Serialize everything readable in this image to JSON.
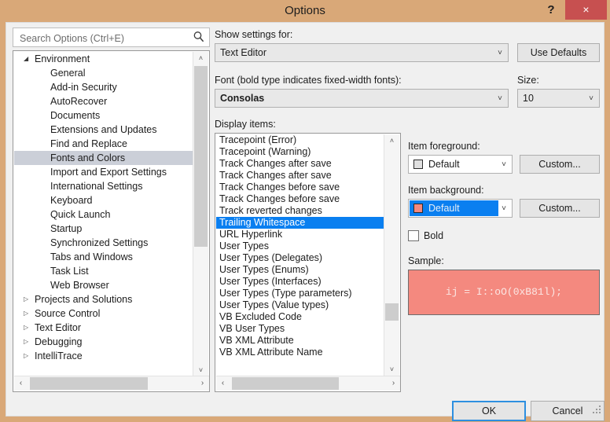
{
  "window": {
    "title": "Options",
    "help_label": "?",
    "close_label": "×",
    "titlebar_color": "#d9a878",
    "close_color": "#c75050"
  },
  "search": {
    "placeholder": "Search Options (Ctrl+E)",
    "value": "",
    "icon": "search-icon"
  },
  "tree": {
    "items": [
      {
        "label": "Environment",
        "level": 0,
        "state": "expanded",
        "selected": false
      },
      {
        "label": "General",
        "level": 1,
        "state": "leaf",
        "selected": false
      },
      {
        "label": "Add-in Security",
        "level": 1,
        "state": "leaf",
        "selected": false
      },
      {
        "label": "AutoRecover",
        "level": 1,
        "state": "leaf",
        "selected": false
      },
      {
        "label": "Documents",
        "level": 1,
        "state": "leaf",
        "selected": false
      },
      {
        "label": "Extensions and Updates",
        "level": 1,
        "state": "leaf",
        "selected": false
      },
      {
        "label": "Find and Replace",
        "level": 1,
        "state": "leaf",
        "selected": false
      },
      {
        "label": "Fonts and Colors",
        "level": 1,
        "state": "leaf",
        "selected": true
      },
      {
        "label": "Import and Export Settings",
        "level": 1,
        "state": "leaf",
        "selected": false
      },
      {
        "label": "International Settings",
        "level": 1,
        "state": "leaf",
        "selected": false
      },
      {
        "label": "Keyboard",
        "level": 1,
        "state": "leaf",
        "selected": false
      },
      {
        "label": "Quick Launch",
        "level": 1,
        "state": "leaf",
        "selected": false
      },
      {
        "label": "Startup",
        "level": 1,
        "state": "leaf",
        "selected": false
      },
      {
        "label": "Synchronized Settings",
        "level": 1,
        "state": "leaf",
        "selected": false
      },
      {
        "label": "Tabs and Windows",
        "level": 1,
        "state": "leaf",
        "selected": false
      },
      {
        "label": "Task List",
        "level": 1,
        "state": "leaf",
        "selected": false
      },
      {
        "label": "Web Browser",
        "level": 1,
        "state": "leaf",
        "selected": false
      },
      {
        "label": "Projects and Solutions",
        "level": 0,
        "state": "collapsed",
        "selected": false
      },
      {
        "label": "Source Control",
        "level": 0,
        "state": "collapsed",
        "selected": false
      },
      {
        "label": "Text Editor",
        "level": 0,
        "state": "collapsed",
        "selected": false
      },
      {
        "label": "Debugging",
        "level": 0,
        "state": "collapsed",
        "selected": false
      },
      {
        "label": "IntelliTrace",
        "level": 0,
        "state": "collapsed",
        "selected": false
      }
    ],
    "selected_label": "Fonts and Colors",
    "expanded_arrow": "◢",
    "collapsed_arrow": "▷",
    "scroll_up": "˄",
    "scroll_down": "˅",
    "scroll_left": "‹",
    "scroll_right": "›"
  },
  "show_settings": {
    "label": "Show settings for:",
    "value": "Text Editor",
    "arrow": "˅"
  },
  "use_defaults": {
    "label": "Use Defaults"
  },
  "font": {
    "label": "Font (bold type indicates fixed-width fonts):",
    "value": "Consolas",
    "arrow": "˅"
  },
  "size": {
    "label": "Size:",
    "value": "10",
    "arrow": "˅"
  },
  "display_items": {
    "label": "Display items:",
    "selected": "Trailing Whitespace",
    "items": [
      {
        "label": "Tracepoint (Error)",
        "selected": false
      },
      {
        "label": "Tracepoint (Warning)",
        "selected": false
      },
      {
        "label": "Track Changes after save",
        "selected": false
      },
      {
        "label": "Track Changes after save",
        "selected": false
      },
      {
        "label": "Track Changes before save",
        "selected": false
      },
      {
        "label": "Track Changes before save",
        "selected": false
      },
      {
        "label": "Track reverted changes",
        "selected": false
      },
      {
        "label": "Trailing Whitespace",
        "selected": true
      },
      {
        "label": "URL Hyperlink",
        "selected": false
      },
      {
        "label": "User Types",
        "selected": false
      },
      {
        "label": "User Types (Delegates)",
        "selected": false
      },
      {
        "label": "User Types (Enums)",
        "selected": false
      },
      {
        "label": "User Types (Interfaces)",
        "selected": false
      },
      {
        "label": "User Types (Type parameters)",
        "selected": false
      },
      {
        "label": "User Types (Value types)",
        "selected": false
      },
      {
        "label": "VB Excluded Code",
        "selected": false
      },
      {
        "label": "VB User Types",
        "selected": false
      },
      {
        "label": "VB XML Attribute",
        "selected": false
      },
      {
        "label": "VB XML Attribute Name",
        "selected": false
      }
    ],
    "selection_color": "#0a7ff0"
  },
  "item_foreground": {
    "label": "Item foreground:",
    "value": "Default",
    "swatch_color": "#e0e0e0",
    "arrow": "˅",
    "custom_label": "Custom..."
  },
  "item_background": {
    "label": "Item background:",
    "value": "Default",
    "swatch_color": "#f4897f",
    "arrow": "˅",
    "custom_label": "Custom...",
    "highlighted": true
  },
  "bold": {
    "label": "Bold",
    "checked": false
  },
  "sample": {
    "label": "Sample:",
    "text": "ij = I::oO(0xB81l);",
    "background_color": "#f4897f",
    "text_color": "#fbe6e3"
  },
  "footer": {
    "ok_label": "OK",
    "cancel_label": "Cancel"
  }
}
